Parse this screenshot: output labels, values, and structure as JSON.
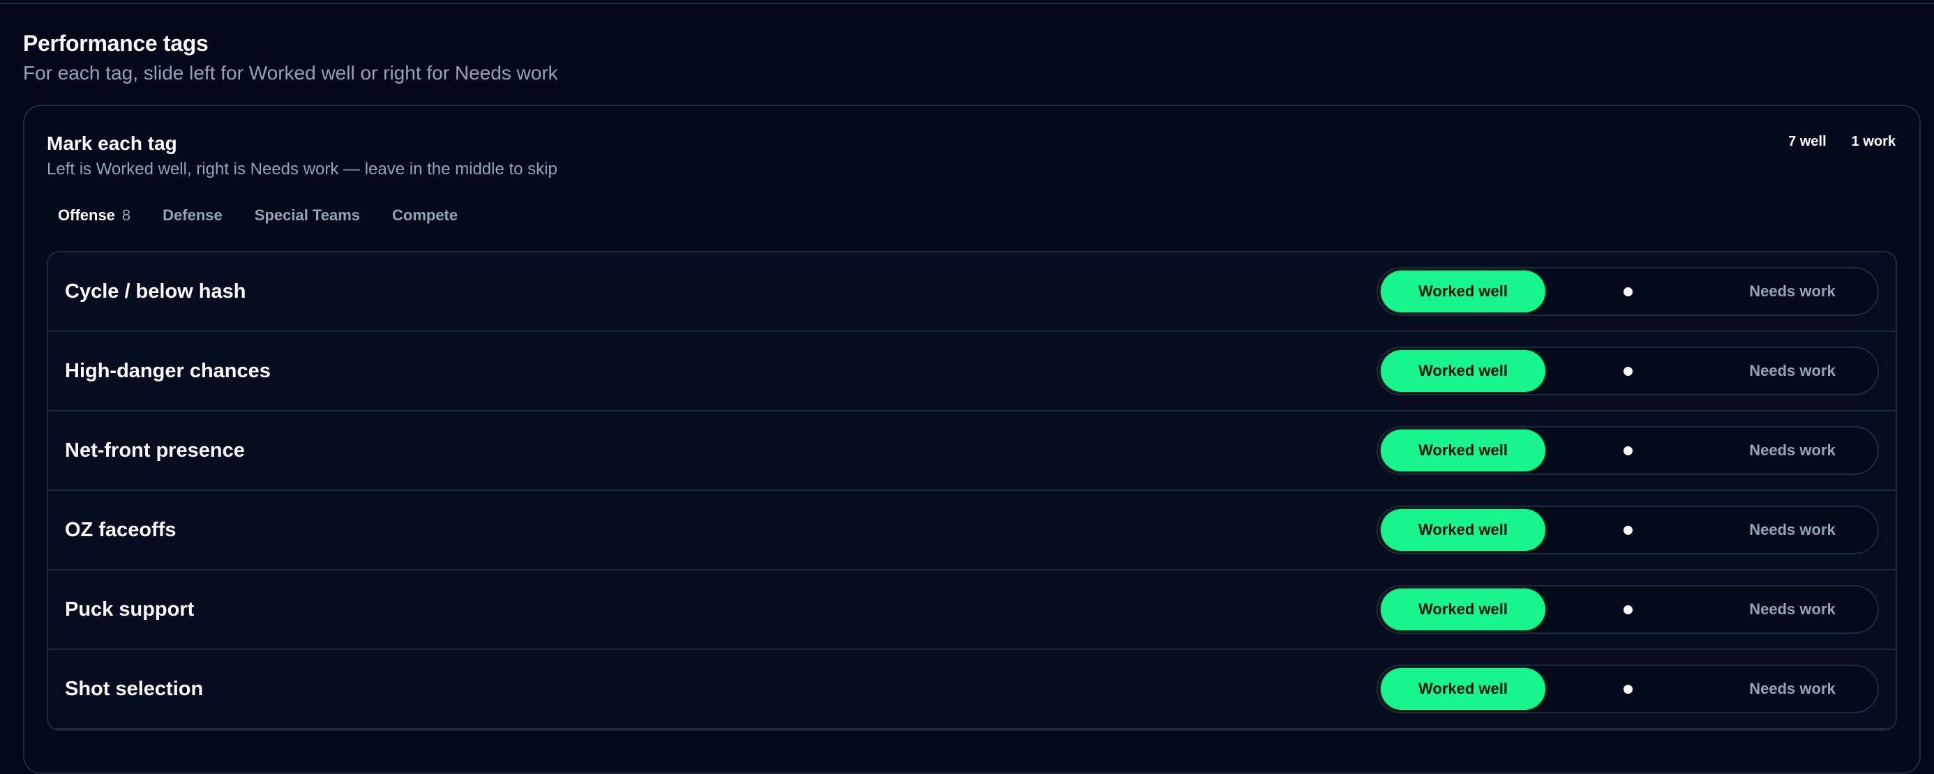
{
  "header": {
    "title": "Performance tags",
    "subtitle": "For each tag, slide left for Worked well or right for Needs work"
  },
  "card": {
    "title": "Mark each tag",
    "description": "Left is Worked well, right is Needs work — leave in the middle to skip",
    "counts": {
      "well": "7 well",
      "work": "1 work"
    }
  },
  "tabs": [
    {
      "label": "Offense",
      "count": "8",
      "active": true
    },
    {
      "label": "Defense",
      "count": "",
      "active": false
    },
    {
      "label": "Special Teams",
      "count": "",
      "active": false
    },
    {
      "label": "Compete",
      "count": "",
      "active": false
    }
  ],
  "slider_labels": {
    "left": "Worked well",
    "right": "Needs work"
  },
  "rows": [
    {
      "label": "Cycle / below hash",
      "value": "worked_well"
    },
    {
      "label": "High-danger chances",
      "value": "worked_well"
    },
    {
      "label": "Net-front presence",
      "value": "worked_well"
    },
    {
      "label": "OZ faceoffs",
      "value": "worked_well"
    },
    {
      "label": "Puck support",
      "value": "worked_well"
    },
    {
      "label": "Shot selection",
      "value": "worked_well"
    }
  ],
  "colors": {
    "background": "#020817",
    "accent": "#19f58d",
    "border": "#1e293b",
    "muted_text": "#94a3b8"
  }
}
